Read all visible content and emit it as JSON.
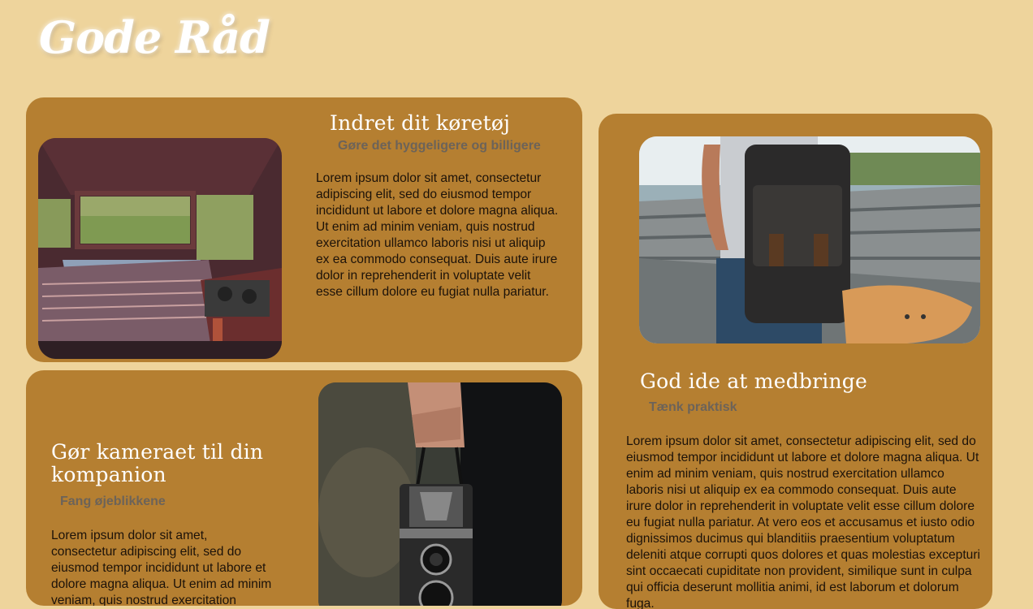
{
  "site": {
    "logo": "Gode Råd"
  },
  "cards": [
    {
      "title": "Indret dit køretøj",
      "subtitle": "Gøre det hyggeligere og billigere",
      "body": "Lorem ipsum dolor sit amet, consectetur adipiscing elit, sed do eiusmod tempor incididunt ut labore et dolore magna aliqua. Ut enim ad minim veniam, quis nostrud exercitation ullamco laboris nisi ut aliquip ex ea commodo consequat. Duis aute irure dolor in reprehenderit in voluptate velit esse cillum dolore eu fugiat nulla pariatur.",
      "image": "van-interior-photo"
    },
    {
      "title": "Gør kameraet til din kompanion",
      "subtitle": "Fang øjeblikkene",
      "body": "Lorem ipsum dolor sit amet, consectetur adipiscing elit, sed do eiusmod tempor incididunt ut labore et dolore magna aliqua. Ut enim ad minim veniam, quis nostrud exercitation",
      "image": "vintage-camera-photo"
    },
    {
      "title": "God ide at medbringe",
      "subtitle": "Tænk praktisk",
      "body": "Lorem ipsum dolor sit amet, consectetur adipiscing elit, sed do eiusmod tempor incididunt ut labore et dolore magna aliqua. Ut enim ad minim veniam, quis nostrud exercitation ullamco laboris nisi ut aliquip ex ea commodo consequat. Duis aute irure dolor in reprehenderit in voluptate velit esse cillum dolore eu fugiat nulla pariatur. At vero eos et accusamus et iusto odio dignissimos ducimus qui blanditiis praesentium voluptatum deleniti atque corrupti quos dolores et quas molestias excepturi sint occaecati cupiditate non provident, similique sunt in culpa qui officia deserunt mollitia animi, id est laborum et dolorum fuga.",
      "image": "backpack-skateboard-photo"
    }
  ],
  "colors": {
    "background": "#eed49c",
    "card": "#b57f31",
    "title": "#ffffff",
    "subtitle": "#6c6359",
    "text": "#1c1209"
  }
}
